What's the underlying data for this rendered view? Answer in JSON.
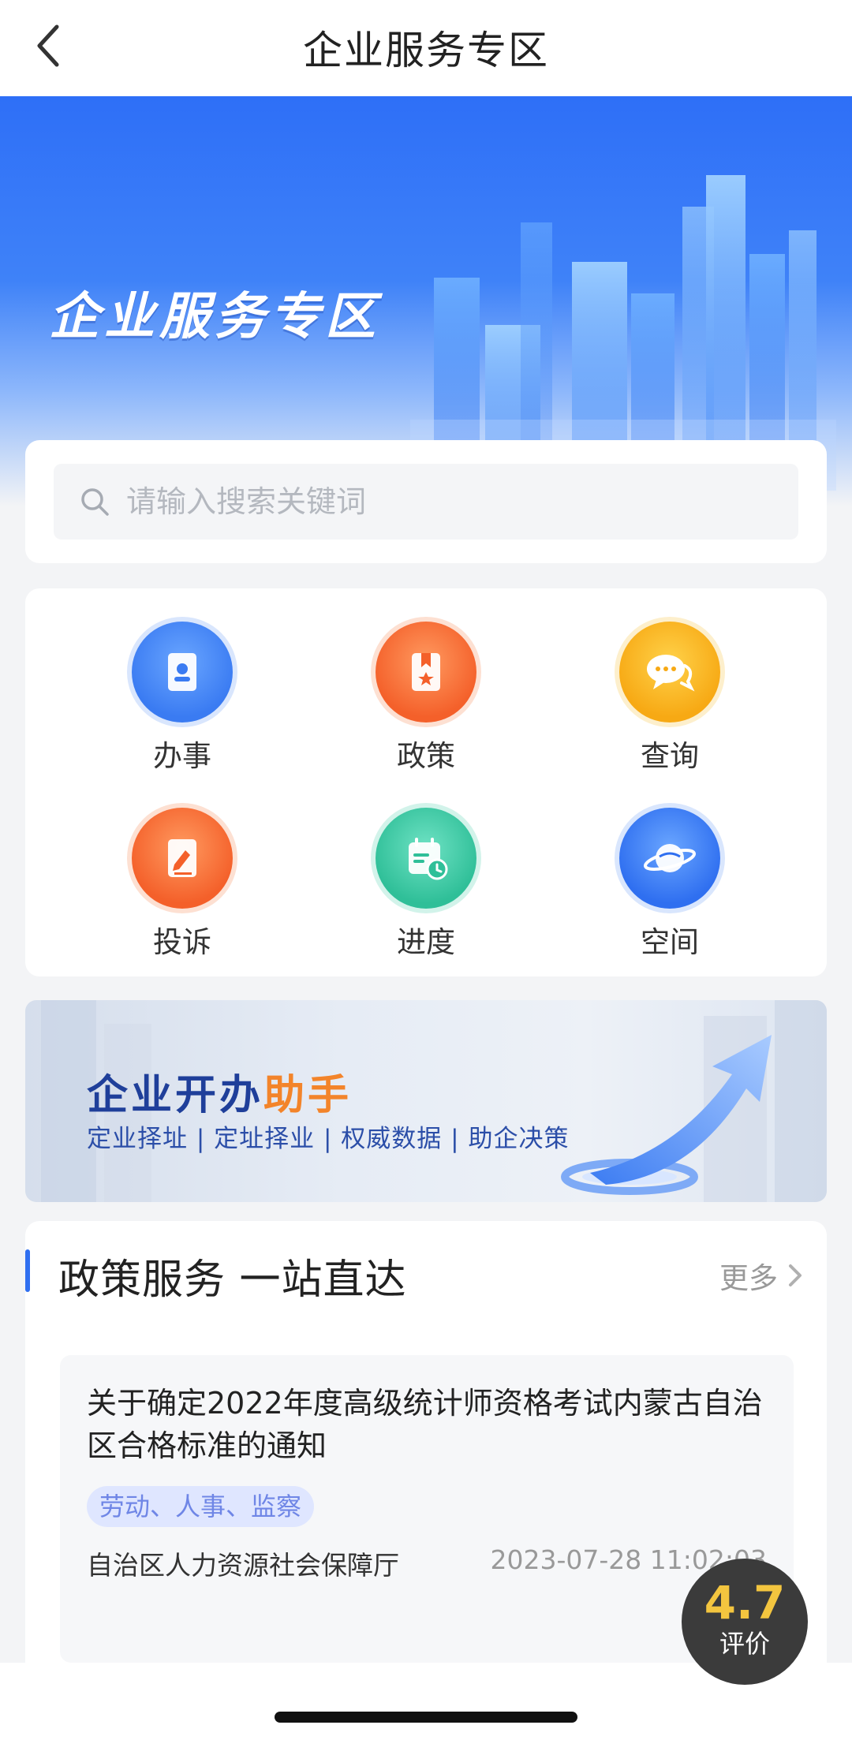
{
  "nav": {
    "title": "企业服务专区"
  },
  "hero": {
    "title": "企业服务专区"
  },
  "search": {
    "placeholder": "请输入搜索关键词"
  },
  "menu": {
    "items": [
      {
        "label": "办事",
        "icon": "document-person-icon",
        "color": "#3a7bf2"
      },
      {
        "label": "政策",
        "icon": "policy-book-icon",
        "color": "#f4602a"
      },
      {
        "label": "查询",
        "icon": "chat-bubble-icon",
        "color": "#f7a914"
      },
      {
        "label": "投诉",
        "icon": "complaint-document-icon",
        "color": "#f4602a"
      },
      {
        "label": "进度",
        "icon": "calendar-clock-icon",
        "color": "#2fbf98"
      },
      {
        "label": "空间",
        "icon": "planet-icon",
        "color": "#2f6ff0"
      }
    ]
  },
  "promo": {
    "title_main": "企业开办",
    "title_accent": "助手",
    "subtitle": "定业择址 | 定址择业 | 权威数据 | 助企决策"
  },
  "policy": {
    "title": "政策服务 一站直达",
    "more": "更多",
    "items": [
      {
        "title": "关于确定2022年度高级统计师资格考试内蒙古自治区合格标准的通知",
        "tag": "劳动、人事、监察",
        "source": "自治区人力资源社会保障厅",
        "time": "2023-07-28 11:02:03"
      }
    ]
  },
  "rating": {
    "score": "4.7",
    "label": "评价"
  },
  "colors": {
    "primary": "#2f6ff0",
    "accent_orange": "#f3842a",
    "rating_gold": "#f3c53f"
  }
}
